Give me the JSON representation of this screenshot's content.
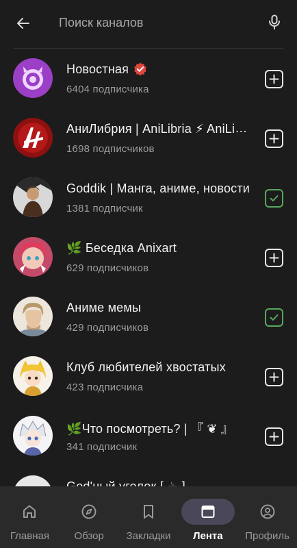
{
  "search": {
    "placeholder": "Поиск каналов",
    "back_icon": "arrow-left-icon",
    "mic_icon": "microphone-icon"
  },
  "colors": {
    "background": "#1c1c1c",
    "nav_background": "#2a2a2a",
    "active_pill": "#4a4858",
    "subscribed_green": "#58a85c",
    "verified_red": "#e0453e"
  },
  "channels": [
    {
      "name": "Новостная",
      "subscribers": "6404 подписчика",
      "verified": true,
      "status": "add"
    },
    {
      "name": "АниЛибрия | AniLibria ⚡ AniLibria",
      "subscribers": "1698 подписчиков",
      "verified": false,
      "status": "add"
    },
    {
      "name": "Goddik | Манга, аниме, новости",
      "subscribers": "1381 подписчик",
      "verified": false,
      "status": "subscribed"
    },
    {
      "name": "🌿 Беседка Anixart",
      "subscribers": "629 подписчиков",
      "verified": false,
      "status": "add"
    },
    {
      "name": "Аниме мемы",
      "subscribers": "429 подписчиков",
      "verified": false,
      "status": "subscribed"
    },
    {
      "name": "Клуб любителей хвостатых",
      "subscribers": "423 подписчика",
      "verified": false,
      "status": "add"
    },
    {
      "name": "🌿Что посмотреть? | 『 ❦ 』",
      "subscribers": "341 подписчик",
      "verified": false,
      "status": "add"
    },
    {
      "name": "God'ный уголок [ ☕ ]",
      "subscribers": "",
      "verified": false,
      "status": "add"
    }
  ],
  "nav": [
    {
      "label": "Главная",
      "icon": "home-icon",
      "active": false
    },
    {
      "label": "Обзор",
      "icon": "compass-icon",
      "active": false
    },
    {
      "label": "Закладки",
      "icon": "bookmark-icon",
      "active": false
    },
    {
      "label": "Лента",
      "icon": "feed-icon",
      "active": true
    },
    {
      "label": "Профиль",
      "icon": "profile-icon",
      "active": false
    }
  ]
}
